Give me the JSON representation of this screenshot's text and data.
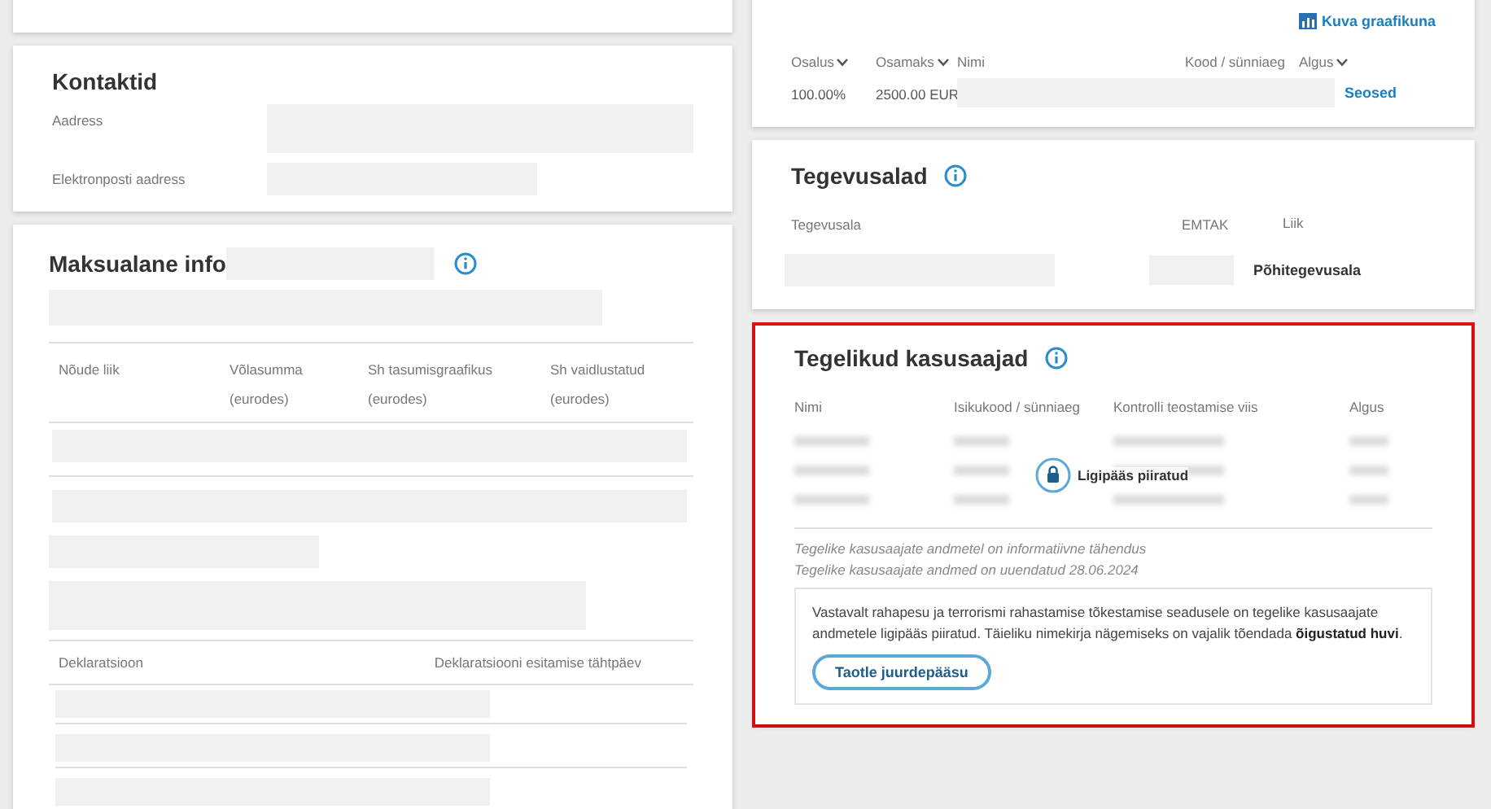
{
  "contacts": {
    "title": "Kontaktid",
    "fields": [
      {
        "label": "Aadress",
        "kind": "tall"
      },
      {
        "label": "Elektronposti aadress",
        "kind": "short"
      }
    ]
  },
  "tax": {
    "title": "Maksualane info",
    "columns": [
      "Nõude liik",
      "Võlasumma\n(eurodes)",
      "Sh tasumisgraafikus\n(eurodes)",
      "Sh vaidlustatud\n(eurodes)"
    ],
    "declaration_columns": [
      "Deklaratsioon",
      "Deklaratsiooni esitamise tähtpäev"
    ]
  },
  "owners": {
    "chart_link": "Kuva graafikuna",
    "columns": [
      {
        "label": "Osalus",
        "sortable": true
      },
      {
        "label": "Osamaks",
        "sortable": true
      },
      {
        "label": "Nimi",
        "sortable": false
      },
      {
        "label": "Kood / sünniaeg",
        "sortable": false
      },
      {
        "label": "Algus",
        "sortable": true
      }
    ],
    "row": {
      "share": "100.00%",
      "contribution": "2500.00 EUR",
      "link": "Seosed"
    }
  },
  "activities": {
    "title": "Tegevusalad",
    "columns": [
      "Tegevusala",
      "EMTAK",
      "Liik"
    ],
    "row": {
      "kind": "Põhitegevusala"
    }
  },
  "beneficiaries": {
    "title": "Tegelikud kasusaajad",
    "highlighted": true,
    "columns": [
      "Nimi",
      "Isikukood / sünniaeg",
      "Kontrolli teostamise viis",
      "Algus"
    ],
    "lock_label": "Ligipääs piiratud",
    "notes": [
      "Tegelike kasusaajate andmetel on informatiivne tähendus",
      "Tegelike kasusaajate andmed on uuendatud 28.06.2024"
    ],
    "notice": "Vastavalt rahapesu ja terrorismi rahastamise tõkestamise seadusele on tegelike kasusaajate andmetele ligipääs piiratud. Täieliku nimekirja nägemiseks on vajalik tõendada **õigustatud huvi**.",
    "button": "Taotle juurdepääsu"
  }
}
